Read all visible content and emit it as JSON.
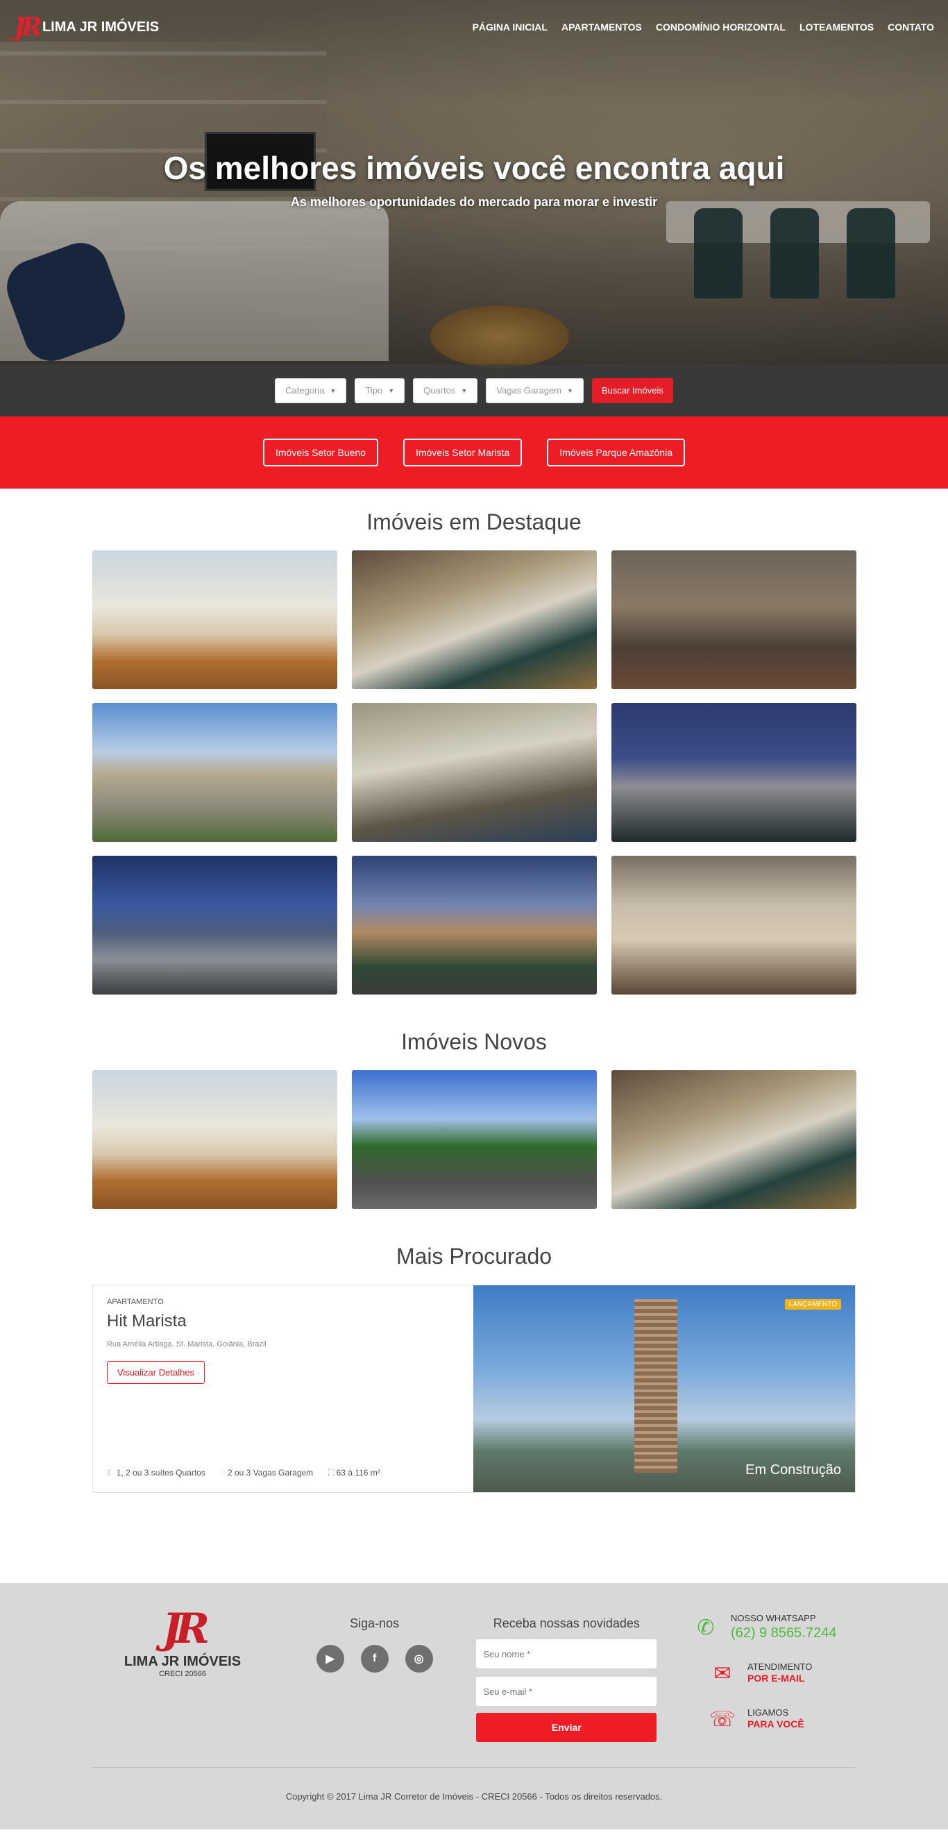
{
  "brand": {
    "name": "LIMA JR IMÓVEIS",
    "mark": "JR",
    "creci": "CRECI 20566"
  },
  "nav": {
    "items": [
      {
        "label": "PÁGINA INICIAL"
      },
      {
        "label": "APARTAMENTOS"
      },
      {
        "label": "CONDOMÍNIO HORIZONTAL"
      },
      {
        "label": "LOTEAMENTOS"
      },
      {
        "label": "CONTATO"
      }
    ]
  },
  "hero": {
    "title": "Os melhores imóveis você encontra aqui",
    "subtitle": "As melhores oportunidades do mercado para morar e investir"
  },
  "search": {
    "filters": [
      {
        "label": "Categoria"
      },
      {
        "label": "Tipo"
      },
      {
        "label": "Quartos"
      },
      {
        "label": "Vagas Garagem"
      }
    ],
    "button": "Buscar Imóveis"
  },
  "quick_links": [
    {
      "label": "Imóveis Setor Bueno"
    },
    {
      "label": "Imóveis Setor Marista"
    },
    {
      "label": "Imóveis Parque Amazônia"
    }
  ],
  "sections": {
    "destaque": "Imóveis em Destaque",
    "novos": "Imóveis Novos",
    "procurado": "Mais Procurado"
  },
  "featured": {
    "type": "APARTAMENTO",
    "name": "Hit Marista",
    "address": "Rua Amélia Artiaga, St. Marista, Goiânia, Brazil",
    "button": "Visualizar Detalhes",
    "features": [
      {
        "icon": "moon-icon",
        "text": "1, 2 ou 3 suítes Quartos"
      },
      {
        "icon": "drop-icon",
        "text": "2 ou 3 Vagas Garagem"
      },
      {
        "icon": "area-icon",
        "text": "63 à 116 m²"
      }
    ],
    "badge": "LANÇAMENTO",
    "status": "Em Construção"
  },
  "footer": {
    "social_title": "Siga-nos",
    "social": [
      {
        "icon": "youtube-icon"
      },
      {
        "icon": "facebook-icon"
      },
      {
        "icon": "instagram-icon"
      }
    ],
    "newsletter_title": "Receba nossas novidades",
    "name_placeholder": "Seu nome *",
    "email_placeholder": "Seu e-mail *",
    "send": "Enviar",
    "whatsapp_label": "NOSSO WHATSAPP",
    "whatsapp_number": "(62) 9 8565.7244",
    "email_l1": "ATENDIMENTO",
    "email_l2": "POR E-MAIL",
    "call_l1": "LIGAMOS",
    "call_l2": "PARA VOCÊ",
    "copyright": "Copyright © 2017 Lima JR Corretor de Imóveis - CRECI 20566 - Todos os direitos reservados."
  },
  "colors": {
    "accent": "#ee1c25",
    "footer_bg": "#d8d8d8",
    "whatsapp": "#4db93b",
    "badge": "#f0b41d"
  }
}
